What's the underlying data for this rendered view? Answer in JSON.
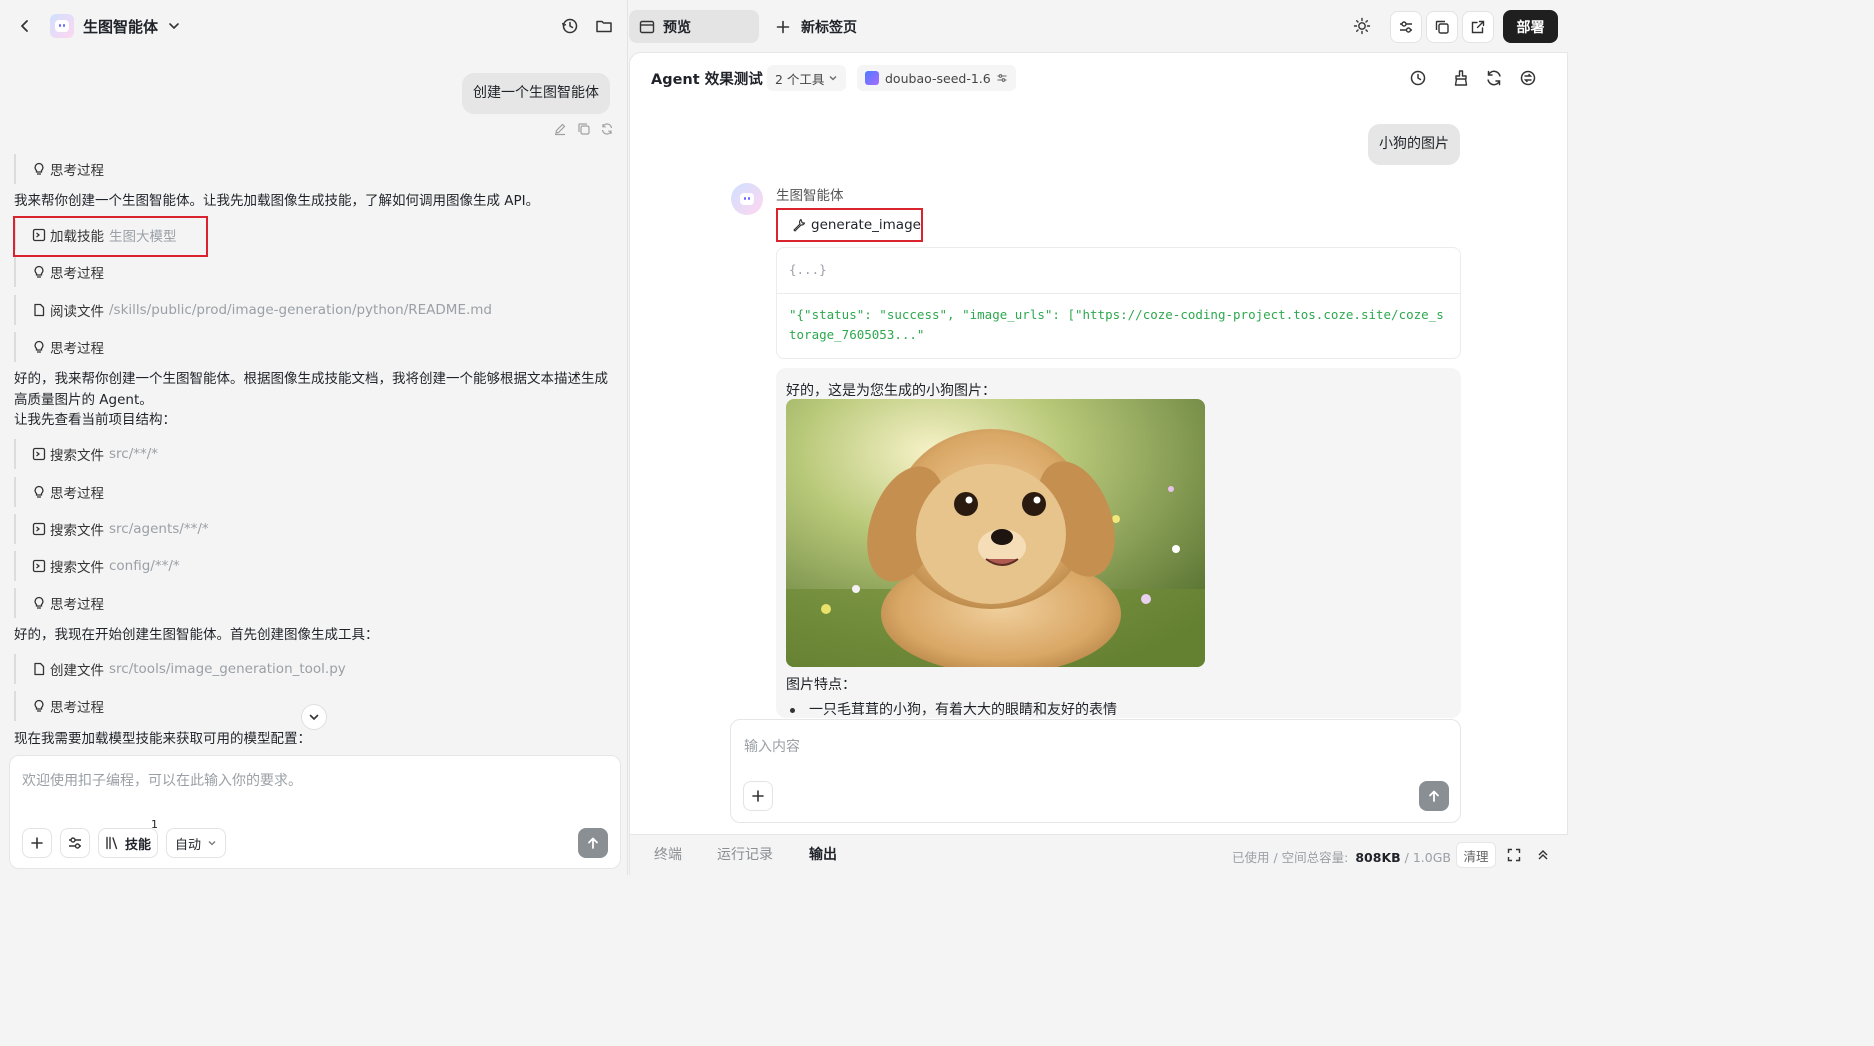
{
  "left": {
    "title": "生图智能体",
    "user_message": "创建一个生图智能体",
    "steps": [
      {
        "type": "think",
        "label": "思考过程"
      },
      {
        "type": "text",
        "text": "我来帮你创建一个生图智能体。让我先加载图像生成技能，了解如何调用图像生成 API。"
      },
      {
        "type": "action",
        "label": "加载技能",
        "path": "生图大模型"
      },
      {
        "type": "think",
        "label": "思考过程"
      },
      {
        "type": "file",
        "label": "阅读文件",
        "path": "/skills/public/prod/image-generation/python/README.md"
      },
      {
        "type": "think",
        "label": "思考过程"
      },
      {
        "type": "text",
        "text": "好的，我来帮你创建一个生图智能体。根据图像生成技能文档，我将创建一个能够根据文本描述生成高质量图片的 Agent。"
      },
      {
        "type": "text",
        "text": "让我先查看当前项目结构："
      },
      {
        "type": "action",
        "label": "搜索文件",
        "path": "src/**/*"
      },
      {
        "type": "think",
        "label": "思考过程"
      },
      {
        "type": "action",
        "label": "搜索文件",
        "path": "src/agents/**/*"
      },
      {
        "type": "action",
        "label": "搜索文件",
        "path": "config/**/*"
      },
      {
        "type": "think",
        "label": "思考过程"
      },
      {
        "type": "text",
        "text": "好的，我现在开始创建生图智能体。首先创建图像生成工具："
      },
      {
        "type": "file",
        "label": "创建文件",
        "path": "src/tools/image_generation_tool.py"
      },
      {
        "type": "think",
        "label": "思考过程"
      },
      {
        "type": "text",
        "text": "现在我需要加载模型技能来获取可用的模型配置："
      }
    ],
    "composer": {
      "placeholder": "欢迎使用扣子编程，可以在此输入你的要求。",
      "skills_label": "技能",
      "skills_count": "1",
      "mode_label": "自动"
    }
  },
  "tabs": {
    "preview": "预览",
    "new_tab": "新标签页",
    "deploy": "部署"
  },
  "right": {
    "header_title": "Agent 效果测试",
    "tools_chip": "2 个工具",
    "model_chip": "doubao-seed-1.6",
    "user_message": "小狗的图片",
    "agent_name": "生图智能体",
    "tool_call": "generate_image",
    "code_collapsed": "{...}",
    "code_result": "\"{\"status\": \"success\", \"image_urls\": [\"https://coze-coding-project.tos.coze.site/coze_storage_7605053...\"",
    "reply_intro": "好的，这是为您生成的小狗图片：",
    "features_title": "图片特点：",
    "feature_1": "一只毛茸茸的小狗，有着大大的眼睛和友好的表情",
    "input_placeholder": "输入内容"
  },
  "bottom": {
    "tabs": [
      "终端",
      "运行记录",
      "输出"
    ],
    "active_tab": "输出",
    "storage_prefix": "已使用 / 空间总容量:",
    "storage_used": "808KB",
    "storage_total": "/ 1.0GB",
    "clear_label": "清理"
  }
}
